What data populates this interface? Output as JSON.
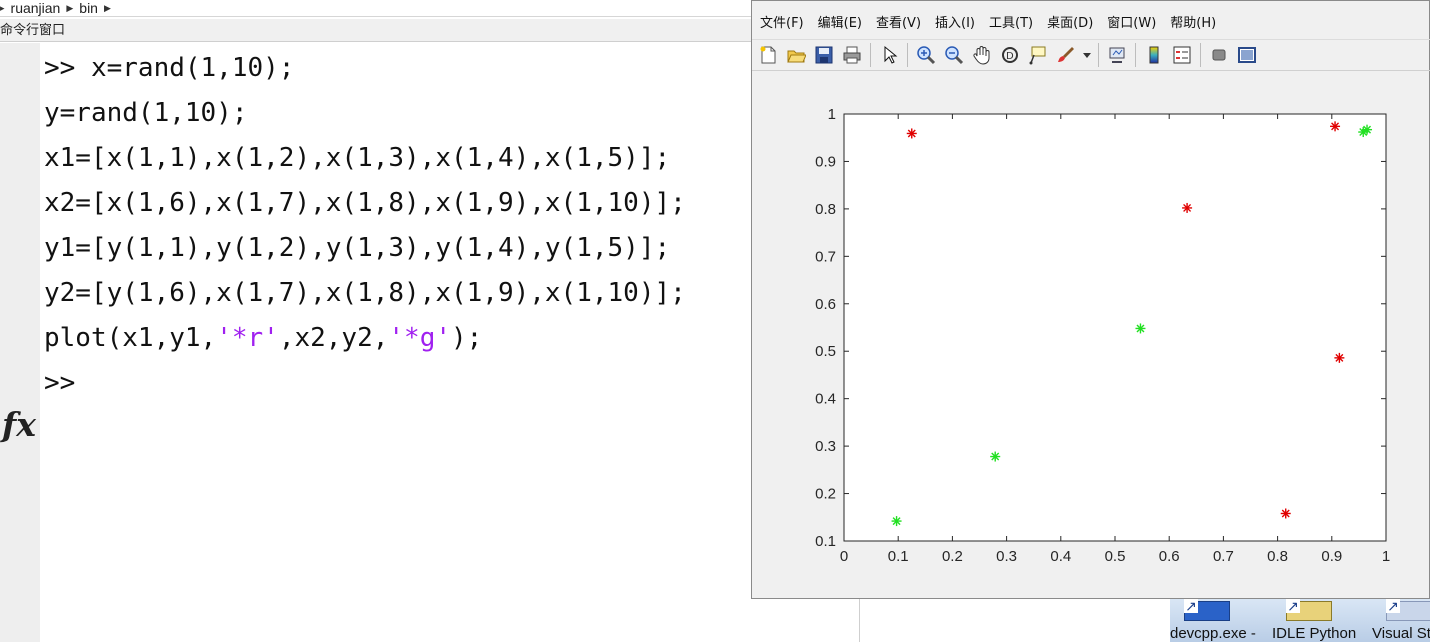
{
  "breadcrumb": {
    "items": [
      "ruanjian",
      "bin"
    ]
  },
  "panel": {
    "title": "命令行窗口"
  },
  "command_window": {
    "prompt_symbol": "fx",
    "lines": [
      {
        "text": ">> x=rand(1,10);"
      },
      {
        "text": "y=rand(1,10);"
      },
      {
        "text": "x1=[x(1,1),x(1,2),x(1,3),x(1,4),x(1,5)];"
      },
      {
        "text": "x2=[x(1,6),x(1,7),x(1,8),x(1,9),x(1,10)];"
      },
      {
        "text": "y1=[y(1,1),y(1,2),y(1,3),y(1,4),y(1,5)];"
      },
      {
        "text": "y2=[y(1,6),x(1,7),x(1,8),x(1,9),x(1,10)];"
      }
    ],
    "plot_line": {
      "pre": "plot(x1,y1,",
      "s1": "'*r'",
      "mid": ",x2,y2,",
      "s2": "'*g'",
      "post": ");"
    },
    "last_prompt": ">>"
  },
  "figure": {
    "menu": [
      "文件(F)",
      "编辑(E)",
      "查看(V)",
      "插入(I)",
      "工具(T)",
      "桌面(D)",
      "窗口(W)",
      "帮助(H)"
    ],
    "toolbar_icons": [
      "new-figure-icon",
      "open-file-icon",
      "save-icon",
      "print-icon",
      "pointer-icon",
      "zoom-in-icon",
      "zoom-out-icon",
      "pan-hand-icon",
      "rotate-3d-icon",
      "data-cursor-icon",
      "brush-icon",
      "link-plot-icon",
      "colorbar-icon",
      "legend-icon",
      "hide-tools-icon",
      "show-tools-icon"
    ]
  },
  "chart_data": {
    "type": "scatter",
    "xlim": [
      0,
      1
    ],
    "ylim": [
      0.1,
      1
    ],
    "xticks": [
      "0",
      "0.1",
      "0.2",
      "0.3",
      "0.4",
      "0.5",
      "0.6",
      "0.7",
      "0.8",
      "0.9",
      "1"
    ],
    "yticks": [
      "0.1",
      "0.2",
      "0.3",
      "0.4",
      "0.5",
      "0.6",
      "0.7",
      "0.8",
      "0.9",
      "1"
    ],
    "grid": false,
    "series": [
      {
        "color": "#e00000",
        "marker": "*",
        "x": [
          0.125,
          0.633,
          0.815,
          0.906,
          0.914
        ],
        "y": [
          0.959,
          0.802,
          0.158,
          0.974,
          0.486
        ]
      },
      {
        "color": "#22e022",
        "marker": "*",
        "x": [
          0.097,
          0.279,
          0.547,
          0.958,
          0.965
        ],
        "y": [
          0.142,
          0.278,
          0.548,
          0.962,
          0.967
        ]
      }
    ]
  },
  "taskbar": {
    "items": [
      {
        "label": "devcpp.exe -"
      },
      {
        "label": "IDLE Python"
      },
      {
        "label": "Visual St"
      }
    ]
  }
}
